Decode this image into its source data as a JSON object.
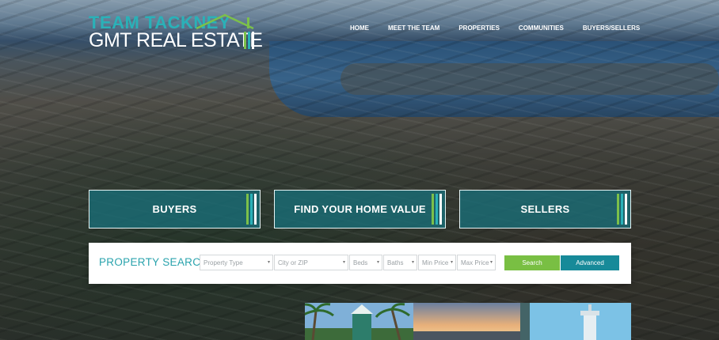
{
  "brand": {
    "line1": "TEAM TACKNEY",
    "line2": "GMT REAL ESTATE",
    "accent_color": "#2ab1b8",
    "roof_color": "#7cc04a"
  },
  "nav": {
    "items": [
      {
        "label": "HOME"
      },
      {
        "label": "MEET THE TEAM"
      },
      {
        "label": "PROPERTIES"
      },
      {
        "label": "COMMUNITIES"
      },
      {
        "label": "BUYERS/SELLERS"
      }
    ]
  },
  "cta": {
    "buyers": "BUYERS",
    "home_value": "FIND YOUR HOME VALUE",
    "sellers": "SELLERS",
    "stripe_colors": [
      "#7cc04a",
      "#2ab1b8",
      "#ffffff"
    ]
  },
  "search": {
    "title": "PROPERTY SEARCH",
    "property_type": "Property Type",
    "city_zip": "City or ZIP",
    "beds": "Beds",
    "baths": "Baths",
    "min_price": "Min Price",
    "max_price": "Max Price",
    "search_label": "Search",
    "advanced_label": "Advanced",
    "search_color": "#79bf43",
    "advanced_color": "#178a99"
  },
  "icons": {
    "caret": "chevron-down-icon",
    "roof": "house-roof-icon"
  }
}
